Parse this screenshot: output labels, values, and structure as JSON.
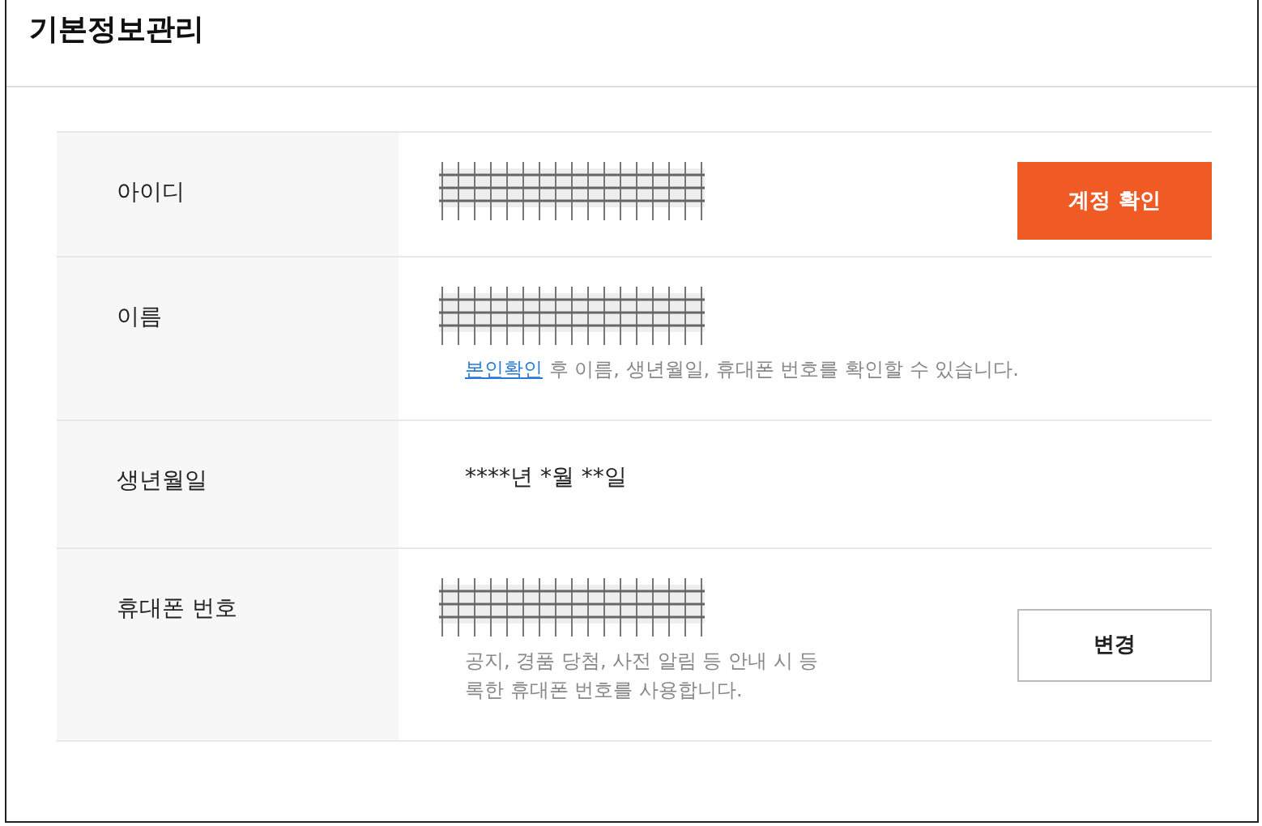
{
  "title": "기본정보관리",
  "rows": [
    {
      "label": "아이디",
      "value": {
        "kind": "redacted"
      },
      "button": {
        "label": "계정 확인",
        "kind": "primary"
      }
    },
    {
      "label": "이름",
      "value": {
        "kind": "redacted"
      },
      "note": {
        "link": "본인확인",
        "text": " 후 이름, 생년월일, 휴대폰 번호를 확인할 수 있습니다."
      }
    },
    {
      "label": "생년월일",
      "value": {
        "kind": "text",
        "text": "****년 *월 **일"
      }
    },
    {
      "label": "휴대폰 번호",
      "value": {
        "kind": "redacted"
      },
      "note": {
        "text": "공지, 경품 당첨, 사전 알림 등 안내 시 등록한 휴대폰 번호를 사용합니다."
      },
      "button": {
        "label": "변경",
        "kind": "secondary"
      }
    }
  ]
}
